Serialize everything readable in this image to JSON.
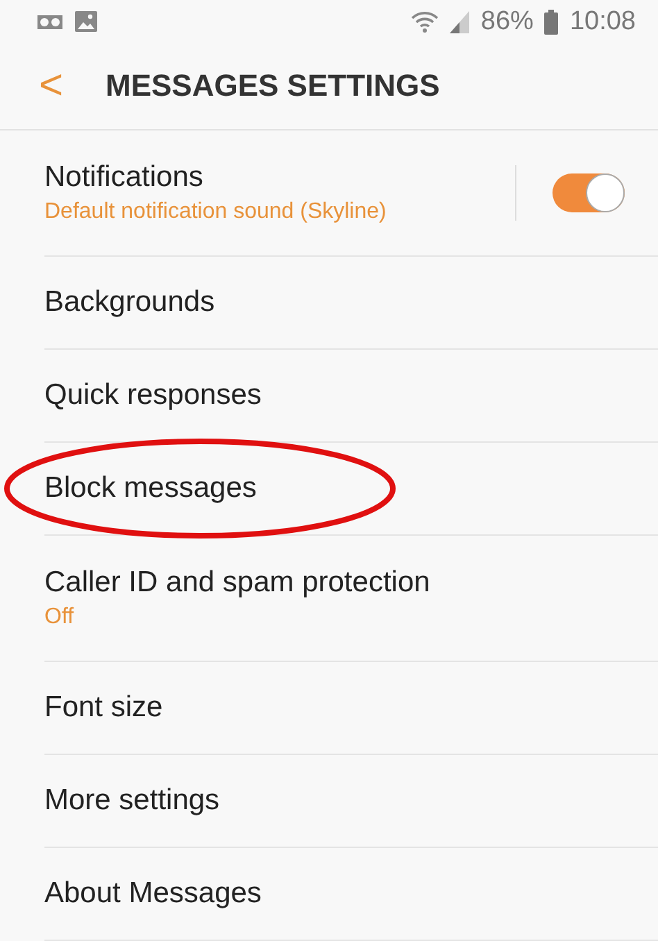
{
  "status_bar": {
    "battery": "86%",
    "time": "10:08"
  },
  "header": {
    "back": "<",
    "title": "MESSAGES SETTINGS"
  },
  "items": [
    {
      "kind": "toggle",
      "label": "Notifications",
      "summary": "Default notification sound (Skyline)",
      "on": true,
      "highlighted": false
    },
    {
      "kind": "plain",
      "label": "Backgrounds",
      "highlighted": false
    },
    {
      "kind": "plain",
      "label": "Quick responses",
      "highlighted": false
    },
    {
      "kind": "plain",
      "label": "Block messages",
      "highlighted": true
    },
    {
      "kind": "plain",
      "label": "Caller ID and spam protection",
      "summary": "Off",
      "highlighted": false
    },
    {
      "kind": "plain",
      "label": "Font size",
      "highlighted": false
    },
    {
      "kind": "plain",
      "label": "More settings",
      "highlighted": false
    },
    {
      "kind": "plain",
      "label": "About Messages",
      "highlighted": false
    }
  ]
}
